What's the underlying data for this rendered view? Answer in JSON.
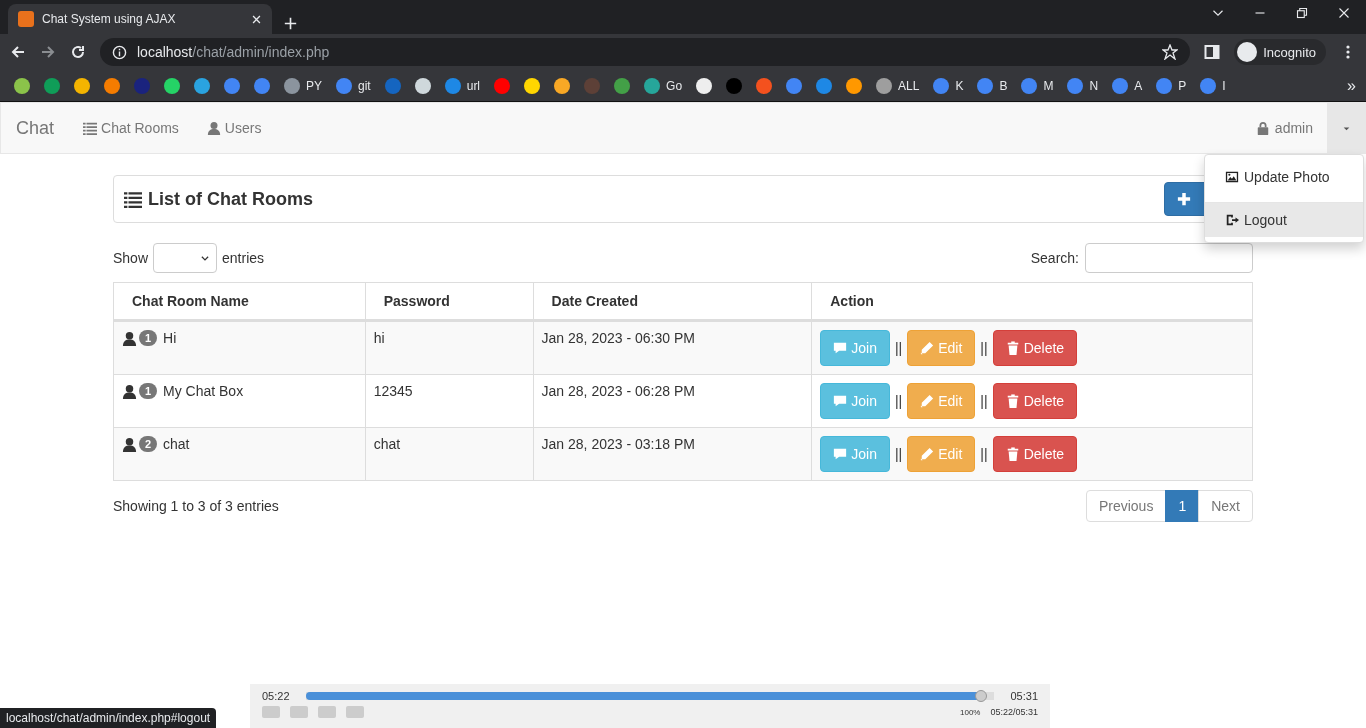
{
  "browser": {
    "tab_title": "Chat System using AJAX",
    "url_host": "localhost",
    "url_path": "/chat/admin/index.php",
    "profile": "Incognito",
    "bookmarks": [
      {
        "color": "#8bc34a"
      },
      {
        "color": "#0f9d58"
      },
      {
        "color": "#f4b400"
      },
      {
        "color": "#f57c00"
      },
      {
        "color": "#1a237e"
      },
      {
        "color": "#25d366"
      },
      {
        "color": "#2aa3e0"
      },
      {
        "color": "#4285f4"
      },
      {
        "color": "#4285f4"
      },
      {
        "color": "#8b949e",
        "label": "PY"
      },
      {
        "color": "#4285f4",
        "label": "git"
      },
      {
        "color": "#1565c0"
      },
      {
        "color": "#cfd8dc"
      },
      {
        "color": "#1e88e5",
        "label": "url"
      },
      {
        "color": "#ff0000"
      },
      {
        "color": "#ffd600"
      },
      {
        "color": "#f9a825"
      },
      {
        "color": "#5d4037"
      },
      {
        "color": "#43a047"
      },
      {
        "color": "#26a69a",
        "label": "Go"
      },
      {
        "color": "#eeeeee"
      },
      {
        "color": "#000000"
      },
      {
        "color": "#f4511e"
      },
      {
        "color": "#4285f4"
      },
      {
        "color": "#1e88e5"
      },
      {
        "color": "#ff9800"
      },
      {
        "color": "#9e9e9e",
        "label": "ALL"
      },
      {
        "color": "#4285f4",
        "label": "K"
      },
      {
        "color": "#4285f4",
        "label": "B"
      },
      {
        "color": "#4285f4",
        "label": "M"
      },
      {
        "color": "#4285f4",
        "label": "N"
      },
      {
        "color": "#4285f4",
        "label": "A"
      },
      {
        "color": "#4285f4",
        "label": "P"
      },
      {
        "color": "#4285f4",
        "label": "I"
      }
    ],
    "more": "»"
  },
  "navbar": {
    "brand": "Chat",
    "links": [
      {
        "kind": "list",
        "label": "Chat Rooms"
      },
      {
        "kind": "user",
        "label": "Users"
      }
    ],
    "user": "admin"
  },
  "dropdown": [
    {
      "kind": "image",
      "label": "Update Photo",
      "selected": false
    },
    {
      "kind": "logout",
      "label": "Logout",
      "selected": true
    }
  ],
  "panel": {
    "title": "List of Chat Rooms"
  },
  "length": {
    "before": "Show",
    "after": "entries"
  },
  "search": {
    "label": "Search:"
  },
  "table": {
    "columns": [
      "Chat Room Name",
      "Password",
      "Date Created",
      "Action"
    ],
    "separator": "||",
    "rows": [
      {
        "name": "Hi",
        "count": "1",
        "password": "hi",
        "date": "Jan 28, 2023 - 06:30 PM",
        "actions": [
          {
            "kind": "join",
            "label": "Join"
          },
          {
            "kind": "edit",
            "label": "Edit"
          },
          {
            "kind": "delete",
            "label": "Delete"
          }
        ]
      },
      {
        "name": "My Chat Box",
        "count": "1",
        "password": "12345",
        "date": "Jan 28, 2023 - 06:28 PM",
        "actions": [
          {
            "kind": "join",
            "label": "Join"
          },
          {
            "kind": "edit",
            "label": "Edit"
          },
          {
            "kind": "delete",
            "label": "Delete"
          }
        ]
      },
      {
        "name": "chat",
        "count": "2",
        "password": "chat",
        "date": "Jan 28, 2023 - 03:18 PM",
        "actions": [
          {
            "kind": "join",
            "label": "Join"
          },
          {
            "kind": "edit",
            "label": "Edit"
          },
          {
            "kind": "delete",
            "label": "Delete"
          }
        ]
      }
    ]
  },
  "info": "Showing 1 to 3 of 3 entries",
  "pagination": [
    {
      "label": "Previous",
      "selected": false
    },
    {
      "label": "1",
      "selected": true
    },
    {
      "label": "Next",
      "selected": false
    }
  ],
  "status_url": "localhost/chat/admin/index.php#logout",
  "player": {
    "elapsed": "05:22",
    "total": "05:31",
    "level": 0.98,
    "volume": "100%",
    "clock": "05:22/05:31"
  }
}
